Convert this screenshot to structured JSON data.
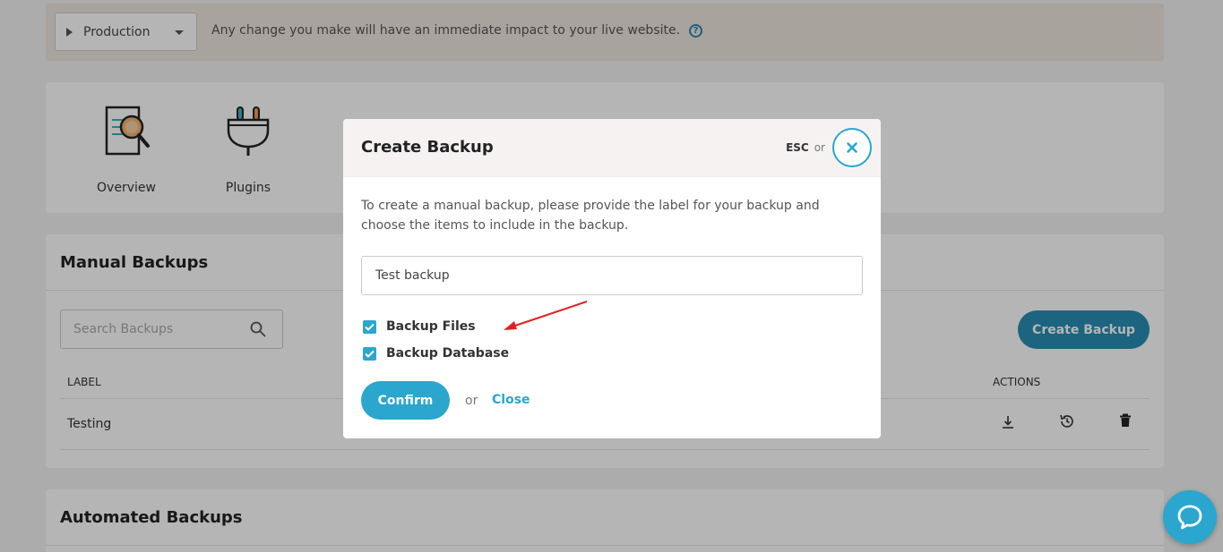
{
  "env_bar": {
    "env_label": "Production",
    "message": "Any change you make will have an immediate impact to your live website.",
    "help_icon": "question-circle-icon"
  },
  "tools": [
    {
      "label": "Overview",
      "icon": "document-search-icon"
    },
    {
      "label": "Plugins",
      "icon": "plug-icon"
    }
  ],
  "manual_backups": {
    "title": "Manual Backups",
    "search_placeholder": "Search Backups",
    "create_label": "Create Backup",
    "columns": {
      "label": "LABEL",
      "actions": "ACTIONS"
    },
    "rows": [
      {
        "label": "Testing"
      }
    ],
    "action_icons": [
      "download-icon",
      "restore-icon",
      "trash-icon"
    ]
  },
  "automated_backups": {
    "title": "Automated Backups"
  },
  "modal": {
    "title": "Create Backup",
    "esc": "ESC",
    "esc_or": "or",
    "description": "To create a manual backup, please provide the label for your backup and choose the items to include in the backup.",
    "label_value": "Test backup",
    "options": [
      {
        "label": "Backup Files",
        "checked": true
      },
      {
        "label": "Backup Database",
        "checked": true
      }
    ],
    "confirm_label": "Confirm",
    "or_text": "or",
    "close_label": "Close"
  },
  "colors": {
    "accent": "#2aa6cf",
    "annotation_arrow": "#e02020"
  }
}
